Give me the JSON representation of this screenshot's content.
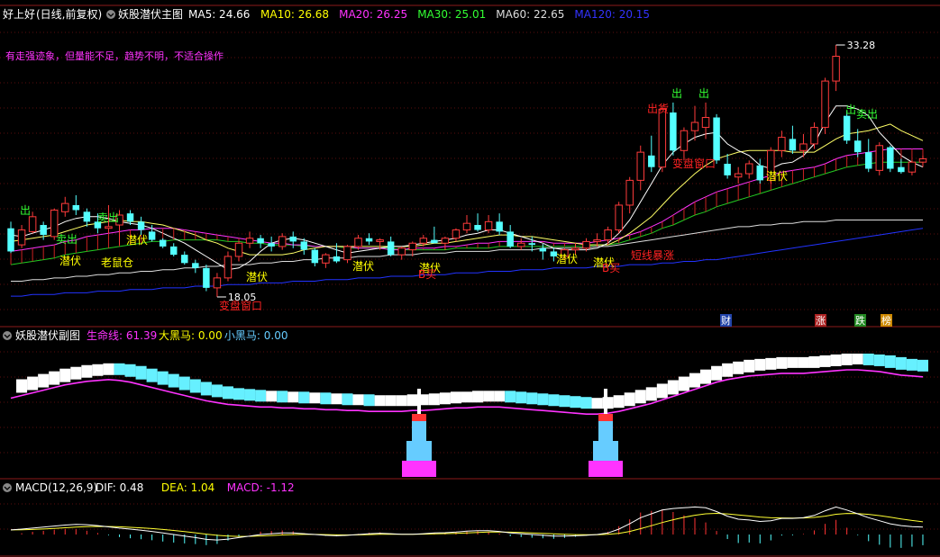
{
  "main_panel": {
    "stock_name": "好上好",
    "period": "(日线,前复权)",
    "indicator": "妖股潜伏主图",
    "ma": [
      {
        "label": "MA5: 24.66",
        "color": "#ffffff"
      },
      {
        "label": "MA10: 26.68",
        "color": "#ffff00"
      },
      {
        "label": "MA20: 26.25",
        "color": "#ff33ff"
      },
      {
        "label": "MA30: 25.01",
        "color": "#33ff33"
      },
      {
        "label": "MA60: 22.65",
        "color": "#dddddd"
      },
      {
        "label": "MA120: 20.15",
        "color": "#3333ff"
      }
    ],
    "comment": "有走强迹象，但量能不足，趋势不明，不适合操作",
    "high_label": "33.28",
    "low_label": "18.05",
    "signals": [
      {
        "text": "出",
        "color": "#33ff33"
      },
      {
        "text": "卖出",
        "color": "#33ff33"
      },
      {
        "text": "卖出",
        "color": "#33ff33"
      },
      {
        "text": "潜伏",
        "color": "#ffff00"
      },
      {
        "text": "潜伏",
        "color": "#ffff00"
      },
      {
        "text": "老鼠仓",
        "color": "#ffff00"
      },
      {
        "text": "潜伏",
        "color": "#ffff00"
      },
      {
        "text": "变盘窗口",
        "color": "#ff2222"
      },
      {
        "text": "潜伏",
        "color": "#ffff00"
      },
      {
        "text": "潜伏",
        "color": "#ffff00"
      },
      {
        "text": "B买",
        "color": "#ff2222"
      },
      {
        "text": "潜伏",
        "color": "#ffff00"
      },
      {
        "text": "潜伏",
        "color": "#ffff00"
      },
      {
        "text": "B买",
        "color": "#ff2222"
      },
      {
        "text": "短线暴涨",
        "color": "#ff2222"
      },
      {
        "text": "变盘窗口",
        "color": "#ff2222"
      },
      {
        "text": "出",
        "color": "#33ff33"
      },
      {
        "text": "出",
        "color": "#33ff33"
      },
      {
        "text": "出货",
        "color": "#ff2222"
      },
      {
        "text": "潜伏",
        "color": "#ffff00"
      },
      {
        "text": "出",
        "color": "#33ff33"
      },
      {
        "text": "卖出",
        "color": "#33ff33"
      }
    ],
    "badges": [
      {
        "text": "财",
        "bg": "#2244aa",
        "fg": "#ffffff"
      },
      {
        "text": "涨",
        "bg": "#aa2222",
        "fg": "#ffffff"
      },
      {
        "text": "跌",
        "bg": "#228822",
        "fg": "#ffffff"
      },
      {
        "text": "榜",
        "bg": "#cc8800",
        "fg": "#ffffff"
      }
    ]
  },
  "sub_panel": {
    "indicator": "妖股潜伏副图",
    "values": [
      {
        "label": "生命线: 61.39",
        "color": "#ff33ff"
      },
      {
        "label": "大黑马: 0.00",
        "color": "#ffff00"
      },
      {
        "label": "小黑马: 0.00",
        "color": "#66ccff"
      }
    ]
  },
  "macd_panel": {
    "indicator": "MACD(12,26,9)",
    "values": [
      {
        "label": "DIF: 0.48",
        "color": "#ffffff"
      },
      {
        "label": "DEA: 1.04",
        "color": "#ffff00"
      },
      {
        "label": "MACD: -1.12",
        "color": "#ff33ff"
      }
    ]
  },
  "chart_data": {
    "type": "candlestick",
    "ylim": [
      18.05,
      33.28
    ],
    "candles": [
      [
        22.2,
        22.6,
        20.7,
        20.8
      ],
      [
        21.2,
        22.4,
        21.0,
        22.1
      ],
      [
        22.0,
        23.2,
        21.9,
        22.9
      ],
      [
        22.4,
        22.6,
        21.5,
        21.8
      ],
      [
        21.7,
        23.4,
        21.5,
        23.3
      ],
      [
        23.2,
        24.1,
        22.9,
        23.7
      ],
      [
        23.6,
        24.2,
        23.0,
        23.3
      ],
      [
        23.2,
        23.4,
        22.3,
        22.6
      ],
      [
        22.6,
        23.1,
        21.9,
        22.2
      ],
      [
        22.2,
        23.6,
        21.9,
        22.3
      ],
      [
        22.4,
        23.3,
        21.2,
        23.0
      ],
      [
        23.1,
        23.3,
        22.4,
        22.6
      ],
      [
        22.6,
        22.9,
        21.8,
        22.1
      ],
      [
        22.0,
        22.4,
        21.4,
        21.5
      ],
      [
        21.5,
        21.6,
        21.0,
        21.1
      ],
      [
        21.1,
        21.3,
        20.5,
        20.6
      ],
      [
        20.6,
        20.8,
        20.0,
        20.1
      ],
      [
        20.1,
        20.3,
        19.5,
        19.8
      ],
      [
        19.8,
        20.0,
        18.4,
        18.6
      ],
      [
        18.6,
        19.5,
        18.05,
        19.2
      ],
      [
        19.2,
        20.8,
        19.0,
        20.5
      ],
      [
        20.5,
        21.4,
        20.2,
        21.3
      ],
      [
        21.3,
        22.0,
        21.0,
        21.6
      ],
      [
        21.6,
        21.8,
        21.0,
        21.3
      ],
      [
        21.3,
        21.7,
        20.8,
        21.1
      ],
      [
        21.1,
        21.9,
        20.9,
        21.7
      ],
      [
        21.7,
        22.0,
        21.0,
        21.4
      ],
      [
        21.4,
        21.6,
        20.6,
        20.9
      ],
      [
        20.9,
        21.0,
        19.9,
        20.1
      ],
      [
        20.1,
        20.7,
        19.8,
        20.6
      ],
      [
        20.5,
        21.3,
        20.1,
        20.2
      ],
      [
        20.3,
        21.2,
        20.1,
        21.1
      ],
      [
        21.1,
        21.8,
        20.9,
        21.6
      ],
      [
        21.6,
        21.9,
        21.2,
        21.4
      ],
      [
        21.4,
        21.6,
        20.9,
        21.5
      ],
      [
        21.4,
        21.7,
        20.5,
        20.6
      ],
      [
        20.6,
        21.1,
        20.3,
        21.0
      ],
      [
        20.9,
        21.4,
        20.5,
        21.3
      ],
      [
        21.3,
        21.8,
        21.1,
        21.6
      ],
      [
        21.5,
        22.3,
        21.3,
        21.3
      ],
      [
        21.3,
        21.7,
        20.9,
        21.6
      ],
      [
        21.6,
        22.2,
        21.4,
        22.1
      ],
      [
        22.1,
        23.0,
        21.9,
        22.5
      ],
      [
        22.4,
        23.1,
        22.0,
        22.1
      ],
      [
        22.1,
        23.0,
        21.9,
        22.6
      ],
      [
        22.6,
        23.1,
        21.8,
        22.0
      ],
      [
        22.0,
        22.4,
        21.0,
        21.1
      ],
      [
        21.1,
        21.6,
        20.9,
        21.3
      ],
      [
        21.3,
        21.7,
        20.8,
        21.2
      ],
      [
        21.0,
        21.3,
        20.3,
        20.8
      ],
      [
        20.8,
        21.0,
        20.2,
        20.5
      ],
      [
        20.5,
        21.0,
        20.3,
        20.9
      ],
      [
        20.9,
        21.3,
        20.6,
        21.0
      ],
      [
        21.0,
        21.6,
        20.8,
        21.4
      ],
      [
        21.4,
        21.9,
        21.1,
        21.5
      ],
      [
        21.5,
        22.3,
        21.3,
        22.1
      ],
      [
        22.1,
        23.8,
        21.9,
        23.6
      ],
      [
        23.6,
        25.3,
        23.1,
        25.1
      ],
      [
        25.1,
        27.2,
        24.5,
        26.8
      ],
      [
        26.6,
        27.8,
        25.6,
        25.9
      ],
      [
        25.9,
        29.6,
        25.6,
        29.4
      ],
      [
        29.2,
        29.8,
        26.6,
        26.9
      ],
      [
        26.9,
        28.3,
        26.3,
        28.1
      ],
      [
        28.1,
        29.6,
        27.5,
        28.6
      ],
      [
        28.3,
        29.8,
        27.6,
        28.9
      ],
      [
        28.9,
        29.1,
        26.1,
        26.3
      ],
      [
        26.1,
        26.7,
        25.2,
        25.4
      ],
      [
        25.3,
        25.9,
        24.9,
        25.5
      ],
      [
        25.5,
        26.3,
        25.2,
        26.1
      ],
      [
        26.0,
        26.4,
        24.9,
        25.1
      ],
      [
        25.1,
        27.1,
        24.9,
        26.9
      ],
      [
        26.9,
        28.1,
        26.5,
        27.7
      ],
      [
        27.6,
        28.4,
        26.7,
        26.9
      ],
      [
        26.9,
        27.9,
        26.5,
        27.3
      ],
      [
        27.3,
        28.6,
        27.0,
        28.3
      ],
      [
        28.3,
        31.3,
        27.9,
        31.1
      ],
      [
        31.1,
        33.28,
        30.5,
        32.6
      ],
      [
        29.0,
        29.3,
        27.3,
        27.5
      ],
      [
        27.5,
        28.2,
        26.5,
        26.8
      ],
      [
        26.8,
        27.6,
        25.6,
        25.8
      ],
      [
        25.7,
        27.4,
        25.4,
        27.2
      ],
      [
        27.1,
        27.2,
        25.6,
        25.8
      ],
      [
        25.9,
        26.4,
        25.5,
        25.6
      ],
      [
        25.6,
        26.3,
        25.4,
        26.2
      ],
      [
        26.2,
        26.6,
        25.9,
        26.4
      ]
    ],
    "ma5": [
      21.8,
      21.7,
      21.9,
      22.1,
      22.3,
      22.6,
      22.8,
      22.9,
      22.9,
      22.8,
      22.6,
      22.5,
      22.4,
      22.2,
      21.9,
      21.6,
      21.3,
      20.9,
      20.5,
      20.1,
      19.7,
      19.8,
      20.2,
      20.8,
      21.3,
      21.5,
      21.6,
      21.5,
      21.3,
      21.1,
      20.9,
      20.7,
      20.8,
      20.9,
      21.0,
      21.1,
      21.1,
      21.2,
      21.3,
      21.4,
      21.5,
      21.6,
      21.8,
      21.9,
      22.1,
      22.1,
      21.9,
      21.7,
      21.5,
      21.3,
      21.0,
      20.9,
      20.9,
      20.9,
      21.0,
      21.3,
      21.9,
      22.7,
      23.8,
      24.9,
      26.0,
      26.8,
      27.3,
      27.7,
      27.9,
      28.0,
      27.3,
      26.9,
      26.6,
      26.0,
      25.8,
      26.1,
      26.2,
      26.6,
      27.3,
      28.6,
      29.6,
      29.6,
      29.4,
      29.0,
      28.0,
      27.3,
      26.6,
      26.2,
      25.9
    ],
    "ma10": [
      21.4,
      21.5,
      21.6,
      21.7,
      21.8,
      22.0,
      22.2,
      22.4,
      22.5,
      22.6,
      22.7,
      22.6,
      22.6,
      22.5,
      22.4,
      22.2,
      22.0,
      21.8,
      21.5,
      21.3,
      21.0,
      20.8,
      20.6,
      20.6,
      20.6,
      20.6,
      20.7,
      20.9,
      21.0,
      21.1,
      21.1,
      21.1,
      21.1,
      21.1,
      21.1,
      21.1,
      21.1,
      21.1,
      21.2,
      21.3,
      21.3,
      21.4,
      21.5,
      21.6,
      21.7,
      21.8,
      21.8,
      21.7,
      21.7,
      21.6,
      21.5,
      21.4,
      21.3,
      21.2,
      21.2,
      21.2,
      21.5,
      21.9,
      22.4,
      22.9,
      23.6,
      24.3,
      24.9,
      25.5,
      26.0,
      26.4,
      26.6,
      26.8,
      26.9,
      26.9,
      26.9,
      26.9,
      26.8,
      26.8,
      26.8,
      27.2,
      27.6,
      27.9,
      28.0,
      28.1,
      28.3,
      28.5,
      28.1,
      27.8,
      27.5
    ],
    "ma20": [
      20.8,
      20.9,
      21.0,
      21.1,
      21.2,
      21.4,
      21.5,
      21.7,
      21.8,
      21.9,
      22.0,
      22.1,
      22.1,
      22.2,
      22.2,
      22.2,
      22.1,
      22.0,
      21.9,
      21.8,
      21.7,
      21.6,
      21.5,
      21.4,
      21.3,
      21.3,
      21.2,
      21.2,
      21.1,
      21.1,
      21.1,
      21.1,
      21.0,
      21.0,
      21.0,
      20.9,
      20.9,
      21.0,
      21.0,
      21.0,
      21.1,
      21.1,
      21.2,
      21.3,
      21.3,
      21.4,
      21.4,
      21.4,
      21.4,
      21.4,
      21.3,
      21.3,
      21.3,
      21.3,
      21.4,
      21.5,
      21.6,
      21.8,
      22.0,
      22.3,
      22.6,
      23.0,
      23.4,
      23.8,
      24.1,
      24.4,
      24.6,
      24.8,
      25.0,
      25.2,
      25.4,
      25.6,
      25.7,
      25.8,
      25.9,
      26.1,
      26.4,
      26.6,
      26.7,
      26.8,
      26.9,
      27.0,
      27.0,
      27.0,
      27.0
    ],
    "ma30": [
      20.0,
      20.1,
      20.2,
      20.3,
      20.4,
      20.6,
      20.7,
      20.8,
      20.9,
      21.0,
      21.1,
      21.2,
      21.3,
      21.4,
      21.4,
      21.5,
      21.5,
      21.5,
      21.5,
      21.5,
      21.4,
      21.4,
      21.3,
      21.3,
      21.2,
      21.2,
      21.2,
      21.1,
      21.1,
      21.1,
      21.1,
      21.0,
      21.0,
      21.0,
      21.0,
      21.0,
      20.9,
      20.9,
      20.9,
      20.9,
      20.9,
      21.0,
      21.0,
      21.0,
      21.0,
      21.1,
      21.1,
      21.1,
      21.1,
      21.1,
      21.1,
      21.1,
      21.1,
      21.1,
      21.2,
      21.2,
      21.3,
      21.5,
      21.7,
      21.9,
      22.2,
      22.4,
      22.7,
      23.0,
      23.2,
      23.5,
      23.7,
      23.9,
      24.1,
      24.3,
      24.5,
      24.7,
      24.9,
      25.1,
      25.3,
      25.5,
      25.7,
      25.9,
      26.0,
      26.1,
      26.2,
      26.2,
      26.2,
      26.2,
      26.2
    ],
    "ma60": [
      19.0,
      19.0,
      19.1,
      19.1,
      19.2,
      19.2,
      19.3,
      19.3,
      19.4,
      19.4,
      19.5,
      19.5,
      19.6,
      19.6,
      19.7,
      19.7,
      19.8,
      19.8,
      19.9,
      19.9,
      20.0,
      20.0,
      20.0,
      20.1,
      20.1,
      20.2,
      20.2,
      20.3,
      20.3,
      20.4,
      20.4,
      20.4,
      20.5,
      20.5,
      20.5,
      20.6,
      20.6,
      20.6,
      20.7,
      20.7,
      20.7,
      20.8,
      20.8,
      20.8,
      20.8,
      20.9,
      20.9,
      20.9,
      20.9,
      21.0,
      21.0,
      21.0,
      21.0,
      21.0,
      21.1,
      21.1,
      21.2,
      21.3,
      21.4,
      21.5,
      21.6,
      21.7,
      21.8,
      21.9,
      22.0,
      22.1,
      22.2,
      22.3,
      22.3,
      22.4,
      22.4,
      22.5,
      22.5,
      22.6,
      22.6,
      22.6,
      22.7,
      22.7,
      22.7,
      22.7,
      22.7,
      22.7,
      22.7,
      22.7,
      22.7
    ],
    "ma120": [
      18.1,
      18.1,
      18.2,
      18.2,
      18.2,
      18.3,
      18.3,
      18.3,
      18.4,
      18.4,
      18.4,
      18.5,
      18.5,
      18.5,
      18.6,
      18.6,
      18.6,
      18.7,
      18.7,
      18.7,
      18.8,
      18.8,
      18.8,
      18.9,
      18.9,
      18.9,
      19.0,
      19.0,
      19.0,
      19.1,
      19.1,
      19.1,
      19.2,
      19.2,
      19.2,
      19.3,
      19.3,
      19.3,
      19.4,
      19.4,
      19.4,
      19.5,
      19.5,
      19.5,
      19.6,
      19.6,
      19.6,
      19.7,
      19.7,
      19.7,
      19.8,
      19.8,
      19.8,
      19.8,
      19.9,
      19.9,
      19.9,
      20.0,
      20.0,
      20.0,
      20.1,
      20.1,
      20.2,
      20.2,
      20.3,
      20.3,
      20.4,
      20.5,
      20.6,
      20.7,
      20.8,
      20.9,
      21.0,
      21.1,
      21.2,
      21.3,
      21.4,
      21.5,
      21.6,
      21.7,
      21.8,
      21.9,
      22.0,
      22.1,
      22.2
    ],
    "lifeline": [
      30,
      33,
      36,
      39,
      42,
      45,
      47,
      49,
      50,
      51,
      50,
      48,
      45,
      42,
      39,
      36,
      33,
      30,
      27,
      25,
      23,
      22,
      21,
      20,
      20,
      19,
      19,
      18,
      18,
      17,
      17,
      16,
      16,
      15,
      15,
      15,
      15,
      16,
      16,
      17,
      18,
      19,
      19,
      20,
      20,
      20,
      19,
      18,
      17,
      16,
      15,
      14,
      13,
      12,
      12,
      13,
      15,
      18,
      21,
      24,
      28,
      32,
      36,
      40,
      44,
      48,
      51,
      53,
      55,
      56,
      57,
      58,
      58,
      58,
      59,
      60,
      61,
      62,
      62,
      61,
      60,
      58,
      56,
      55,
      54
    ],
    "big_horse": [
      0,
      0,
      0,
      0,
      0,
      0,
      0,
      0,
      0,
      0,
      0,
      0,
      0,
      0,
      0,
      0,
      0,
      0,
      0,
      0,
      0,
      0,
      0,
      0,
      0,
      0,
      0,
      0,
      0,
      0,
      0,
      0,
      0,
      0,
      0,
      0,
      0,
      0,
      0,
      0,
      0,
      0,
      0,
      0,
      0,
      0,
      0,
      0,
      0,
      0,
      0,
      0,
      0,
      0,
      0,
      0,
      0,
      0,
      0,
      0,
      0,
      0,
      0,
      0,
      0,
      0,
      0,
      0,
      0,
      0,
      0,
      0,
      0,
      0,
      0,
      0,
      0,
      0,
      0,
      0,
      0,
      0,
      0,
      0,
      0
    ],
    "dif": [
      0.3,
      0.35,
      0.42,
      0.48,
      0.55,
      0.62,
      0.66,
      0.64,
      0.58,
      0.5,
      0.42,
      0.35,
      0.28,
      0.2,
      0.1,
      0.0,
      -0.1,
      -0.2,
      -0.32,
      -0.36,
      -0.3,
      -0.2,
      -0.1,
      0.0,
      0.05,
      0.1,
      0.1,
      0.05,
      0.0,
      -0.05,
      -0.08,
      -0.05,
      0.0,
      0.05,
      0.08,
      0.05,
      0.02,
      0.02,
      0.05,
      0.1,
      0.12,
      0.16,
      0.22,
      0.25,
      0.25,
      0.2,
      0.1,
      0.05,
      0.0,
      -0.05,
      -0.1,
      -0.1,
      -0.08,
      -0.05,
      0.0,
      0.1,
      0.35,
      0.7,
      1.1,
      1.35,
      1.6,
      1.7,
      1.75,
      1.8,
      1.75,
      1.5,
      1.2,
      1.0,
      0.95,
      0.85,
      0.9,
      1.05,
      1.05,
      1.1,
      1.25,
      1.55,
      1.8,
      1.6,
      1.35,
      1.1,
      0.9,
      0.7,
      0.58,
      0.52,
      0.48
    ]
  }
}
